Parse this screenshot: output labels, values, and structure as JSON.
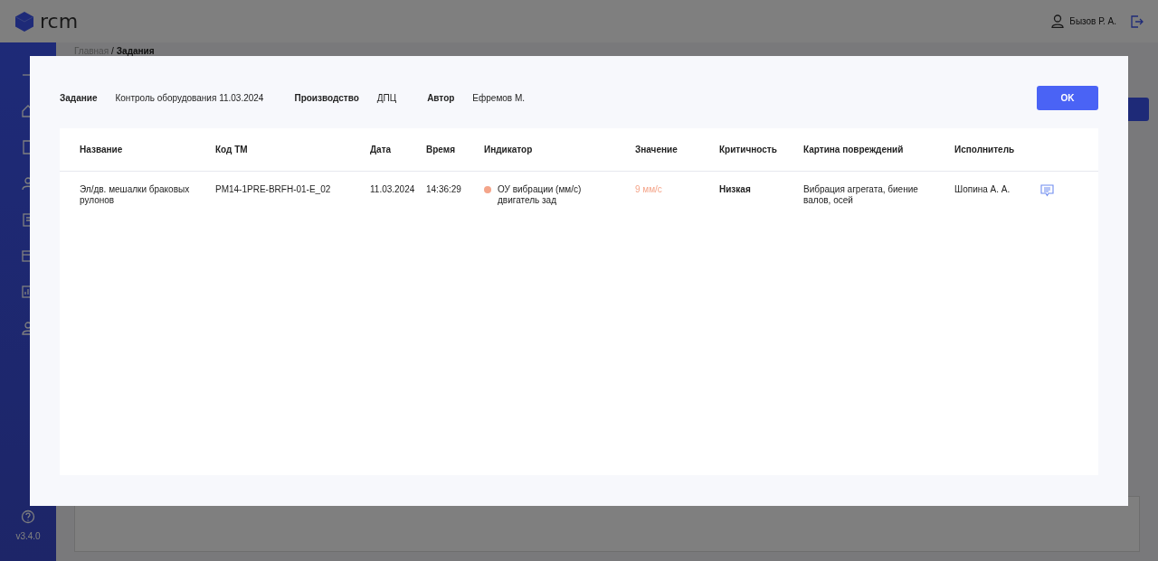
{
  "header": {
    "logo_text": "rcm",
    "user": "Бызов Р. А."
  },
  "sidebar": {
    "version": "v3.4.0"
  },
  "breadcrumb": {
    "parent": "Главная",
    "separator": "/",
    "current": "Задания"
  },
  "modal": {
    "fields": [
      {
        "label": "Задание",
        "value": "Контроль оборудования 11.03.2024"
      },
      {
        "label": "Производство",
        "value": "ДПЦ"
      },
      {
        "label": "Автор",
        "value": "Ефремов М."
      }
    ],
    "ok_button": "OK",
    "table": {
      "columns": [
        "Название",
        "Код ТМ",
        "Дата",
        "Время",
        "Индикатор",
        "Значение",
        "Критичность",
        "Картина повреждений",
        "Исполнитель"
      ],
      "rows": [
        {
          "name": "Эл/дв. мешалки браковых рулонов",
          "code": "PM14-1PRE-BRFH-01-E_02",
          "date": "11.03.2024",
          "time": "14:36:29",
          "indicator": "ОУ вибрации (мм/с) двигатель зад",
          "color": "#f4a58a",
          "value": "9 мм/с",
          "criticality": "Низкая",
          "damage": "Вибрация агрегата, биение валов, осей",
          "executor": "Шопина А. А."
        }
      ]
    }
  }
}
